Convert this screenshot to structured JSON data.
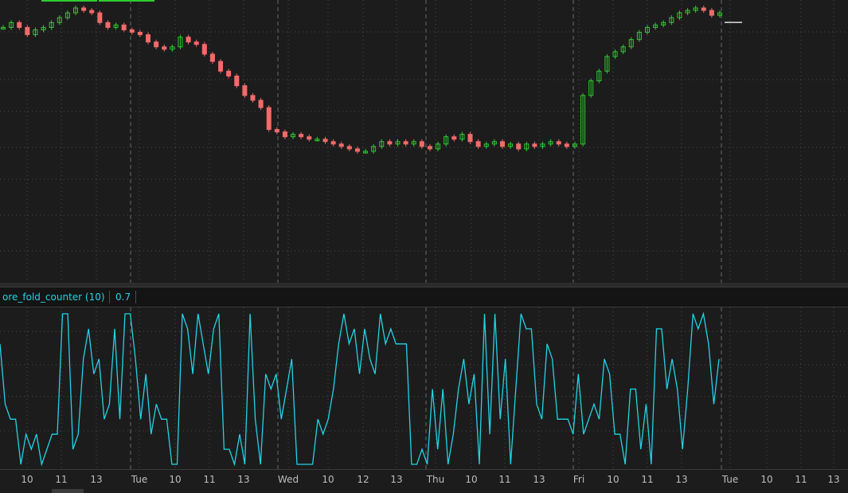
{
  "study": {
    "name": "ore_fold_counter (10)",
    "value": "0.7",
    "line_color": "#22d3e6"
  },
  "colors": {
    "up_candle": "#2ecc2e",
    "down_candle": "#f26a6a",
    "grid": "#4a4a4a",
    "background": "#1c1c1c"
  },
  "time_axis": {
    "ticks": [
      "10",
      "11",
      "13",
      "Tue",
      "10",
      "11",
      "13",
      "Wed",
      "10",
      "12",
      "13",
      "Thu",
      "10",
      "11",
      "13",
      "Fri",
      "10",
      "11",
      "13",
      "Tue",
      "10",
      "11",
      "13"
    ]
  },
  "chart_data": [
    {
      "type": "candlestick",
      "title": "",
      "day_separators": [
        "Tue",
        "Wed",
        "Thu",
        "Fri",
        "Tue"
      ],
      "close_trend": [
        78,
        80,
        78,
        75,
        77,
        78,
        80,
        82,
        84,
        86,
        85,
        84,
        80,
        78,
        79,
        77,
        76,
        75,
        72,
        70,
        69,
        70,
        74,
        72,
        71,
        67,
        64,
        60,
        58,
        54,
        50,
        48,
        45,
        36,
        35,
        33,
        34,
        33,
        32,
        32,
        31,
        30,
        29,
        28,
        27,
        27,
        29,
        31,
        30,
        31,
        30,
        31,
        29,
        28,
        30,
        33,
        32,
        34,
        31,
        29,
        30,
        31,
        29,
        30,
        28,
        30,
        29,
        30,
        31,
        30,
        29,
        30,
        50,
        56,
        60,
        66,
        68,
        70,
        73,
        76,
        78,
        79,
        80,
        82,
        84,
        85,
        86,
        85,
        83,
        84
      ],
      "last_price_marker": 84,
      "grid": true
    },
    {
      "type": "line",
      "title": "ore_fold_counter (10)",
      "ylim": [
        0,
        1
      ],
      "values": [
        0.8,
        0.4,
        0.3,
        0.3,
        0.0,
        0.2,
        0.1,
        0.2,
        0.0,
        0.1,
        0.2,
        0.2,
        1.0,
        1.0,
        0.1,
        0.2,
        0.7,
        0.9,
        0.6,
        0.7,
        0.3,
        0.4,
        0.9,
        0.3,
        1.0,
        1.0,
        0.7,
        0.3,
        0.6,
        0.2,
        0.4,
        0.3,
        0.3,
        0.0,
        0.0,
        1.0,
        0.9,
        0.6,
        1.0,
        0.8,
        0.6,
        0.9,
        1.0,
        0.1,
        0.1,
        0.0,
        0.2,
        0.0,
        1.0,
        0.3,
        0.0,
        0.6,
        0.5,
        0.6,
        0.3,
        0.5,
        0.7,
        0.0,
        0.0,
        0.0,
        0.0,
        0.3,
        0.2,
        0.3,
        0.5,
        0.8,
        1.0,
        0.8,
        0.9,
        0.6,
        0.9,
        0.7,
        0.6,
        1.0,
        0.8,
        0.9,
        0.8,
        0.8,
        0.8,
        0.0,
        0.0,
        0.1,
        0.0,
        0.5,
        0.1,
        0.5,
        0.0,
        0.2,
        0.5,
        0.7,
        0.4,
        0.6,
        0.0,
        1.0,
        0.2,
        1.0,
        0.3,
        0.7,
        0.0,
        0.5,
        1.0,
        0.9,
        0.9,
        0.4,
        0.3,
        0.8,
        0.7,
        0.3,
        0.3,
        0.3,
        0.2,
        0.6,
        0.2,
        0.3,
        0.4,
        0.3,
        0.7,
        0.6,
        0.2,
        0.2,
        0.0,
        0.5,
        0.5,
        0.1,
        0.4,
        0.0,
        0.9,
        0.9,
        0.5,
        0.7,
        0.5,
        0.1,
        0.5,
        1.0,
        0.9,
        1.0,
        0.8,
        0.4,
        0.7
      ]
    }
  ]
}
